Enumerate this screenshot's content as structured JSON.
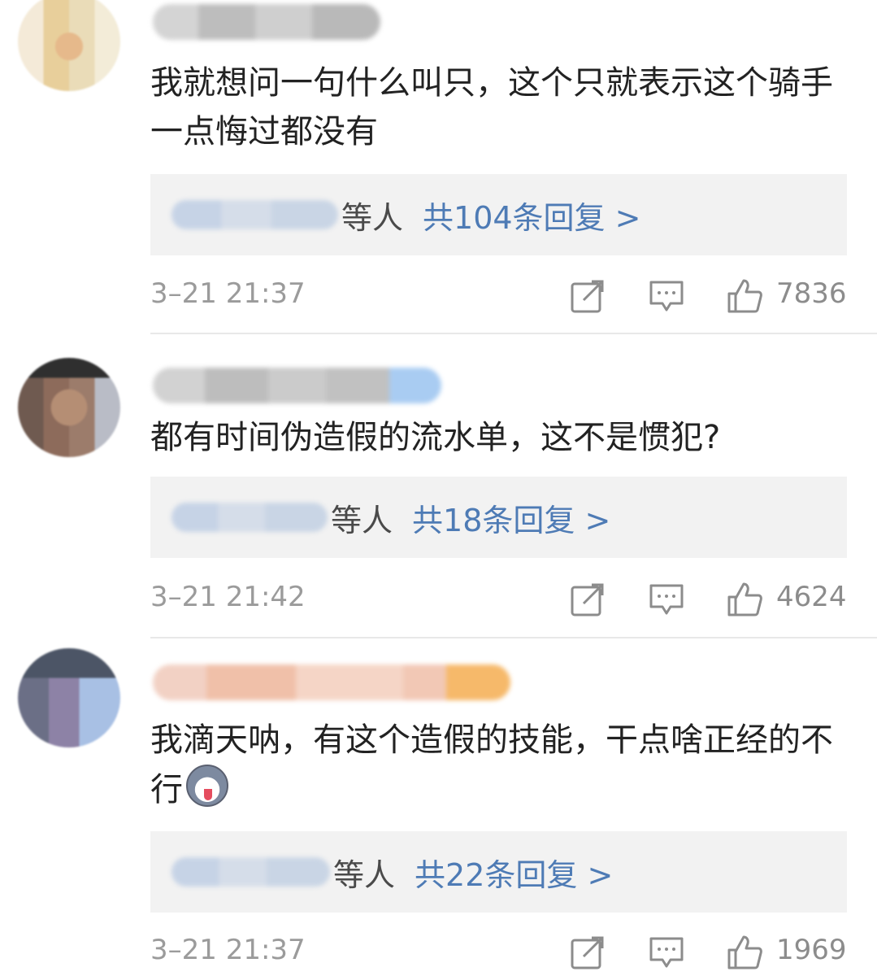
{
  "comments": [
    {
      "text": "我就想问一句什么叫只，这个只就表示这个骑手一点悔过都没有",
      "reply_others": "等人",
      "reply_count": "共104条回复 >",
      "timestamp": "3–21 21:37",
      "likes": "7836"
    },
    {
      "text": "都有时间伪造假的流水单，这不是惯犯?",
      "reply_others": "等人",
      "reply_count": "共18条回复 >",
      "timestamp": "3–21 21:42",
      "likes": "4624"
    },
    {
      "text": "我滴天呐，有这个造假的技能，干点啥正经的不行",
      "emoji": "husky-emoji",
      "reply_others": "等人",
      "reply_count": "共22条回复 >",
      "timestamp": "3–21 21:37",
      "likes": "1969"
    }
  ],
  "icons": {
    "share": "share-icon",
    "comment": "comment-icon",
    "like": "thumbs-up-icon"
  },
  "colors": {
    "link": "#4e7bb5",
    "meta": "#9b9b9b",
    "reply_bg": "#f2f2f2"
  }
}
